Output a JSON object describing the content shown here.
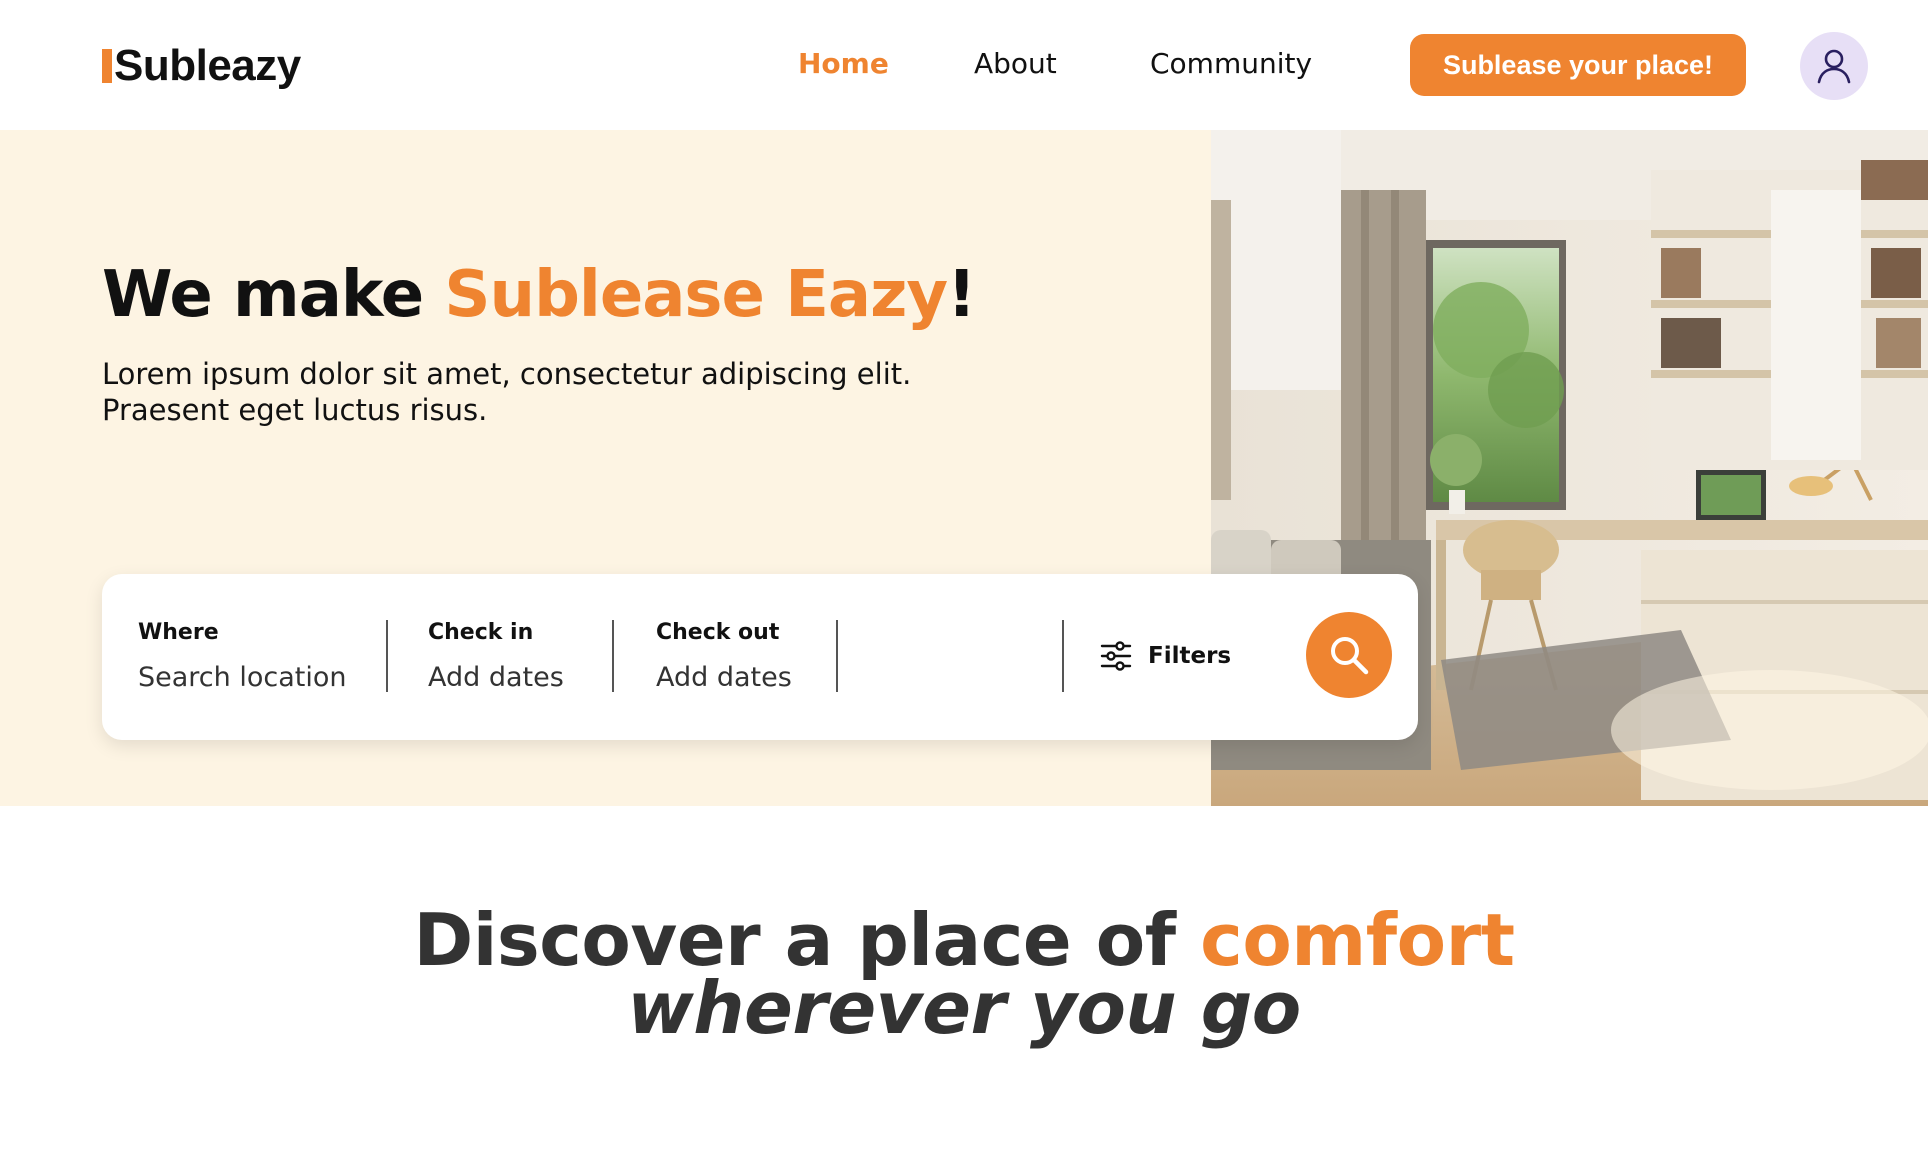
{
  "brand": {
    "name": "Subleazy",
    "accent_color": "#ef8430"
  },
  "nav": {
    "items": [
      {
        "label": "Home",
        "active": true
      },
      {
        "label": "About",
        "active": false
      },
      {
        "label": "Community",
        "active": false
      }
    ],
    "cta_label": "Sublease your place!",
    "avatar_icon": "user-icon"
  },
  "hero": {
    "title_prefix": "We make ",
    "title_accent": "Sublease Eazy",
    "title_suffix": "!",
    "subtitle_line1": "Lorem ipsum dolor sit amet, consectetur adipiscing elit.",
    "subtitle_line2": "Praesent eget luctus risus.",
    "image": "room-photo"
  },
  "search": {
    "where_label": "Where",
    "where_placeholder": "Search location",
    "checkin_label": "Check in",
    "checkin_placeholder": "Add dates",
    "checkout_label": "Check out",
    "checkout_placeholder": "Add dates",
    "filters_label": "Filters",
    "filters_icon": "sliders-icon",
    "search_icon": "search-icon"
  },
  "discover": {
    "line1_prefix": "Discover a place of ",
    "line1_accent": "comfort",
    "line2": "wherever you go"
  }
}
